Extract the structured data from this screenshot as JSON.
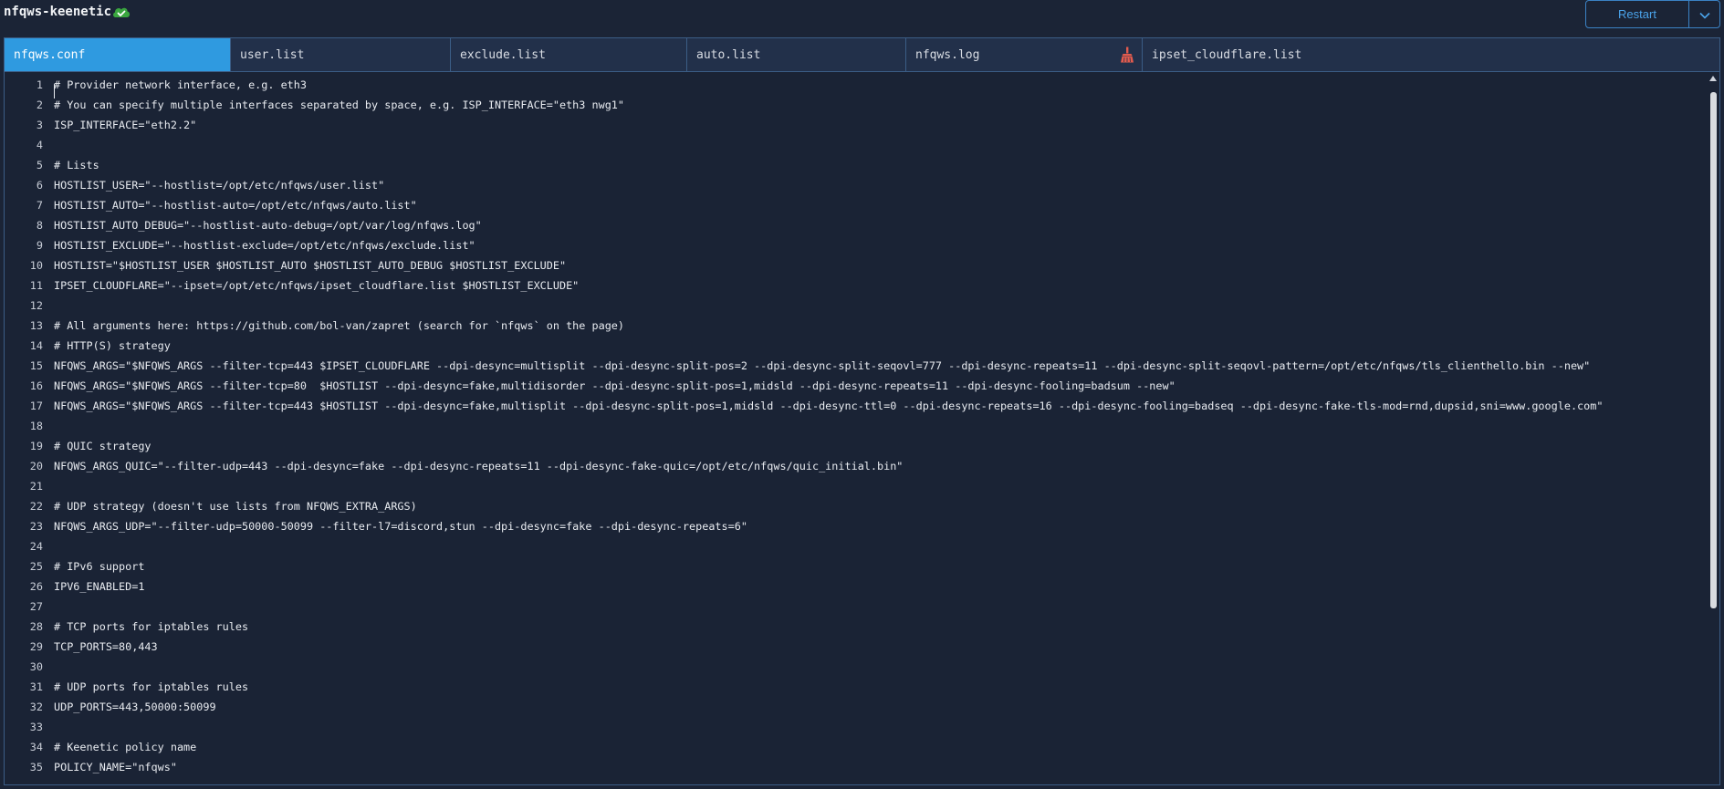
{
  "header": {
    "title": "nfqws-keenetic",
    "status_icon": "cloud-check-icon",
    "restart_label": "Restart"
  },
  "colors": {
    "accent": "#2f9ae0",
    "status_green": "#3aa63f",
    "clear_red": "#e25b4e"
  },
  "tabs": [
    {
      "label": "nfqws.conf",
      "active": true
    },
    {
      "label": "user.list"
    },
    {
      "label": "exclude.list"
    },
    {
      "label": "auto.list"
    },
    {
      "label": "nfqws.log",
      "action_icon": "broom-icon"
    },
    {
      "label": "ipset_cloudflare.list"
    }
  ],
  "editor": {
    "lines": [
      "# Provider network interface, e.g. eth3",
      "# You can specify multiple interfaces separated by space, e.g. ISP_INTERFACE=\"eth3 nwg1\"",
      "ISP_INTERFACE=\"eth2.2\"",
      "",
      "# Lists",
      "HOSTLIST_USER=\"--hostlist=/opt/etc/nfqws/user.list\"",
      "HOSTLIST_AUTO=\"--hostlist-auto=/opt/etc/nfqws/auto.list\"",
      "HOSTLIST_AUTO_DEBUG=\"--hostlist-auto-debug=/opt/var/log/nfqws.log\"",
      "HOSTLIST_EXCLUDE=\"--hostlist-exclude=/opt/etc/nfqws/exclude.list\"",
      "HOSTLIST=\"$HOSTLIST_USER $HOSTLIST_AUTO $HOSTLIST_AUTO_DEBUG $HOSTLIST_EXCLUDE\"",
      "IPSET_CLOUDFLARE=\"--ipset=/opt/etc/nfqws/ipset_cloudflare.list $HOSTLIST_EXCLUDE\"",
      "",
      "# All arguments here: https://github.com/bol-van/zapret (search for `nfqws` on the page)",
      "# HTTP(S) strategy",
      "NFQWS_ARGS=\"$NFQWS_ARGS --filter-tcp=443 $IPSET_CLOUDFLARE --dpi-desync=multisplit --dpi-desync-split-pos=2 --dpi-desync-split-seqovl=777 --dpi-desync-repeats=11 --dpi-desync-split-seqovl-pattern=/opt/etc/nfqws/tls_clienthello.bin --new\"",
      "NFQWS_ARGS=\"$NFQWS_ARGS --filter-tcp=80  $HOSTLIST --dpi-desync=fake,multidisorder --dpi-desync-split-pos=1,midsld --dpi-desync-repeats=11 --dpi-desync-fooling=badsum --new\"",
      "NFQWS_ARGS=\"$NFQWS_ARGS --filter-tcp=443 $HOSTLIST --dpi-desync=fake,multisplit --dpi-desync-split-pos=1,midsld --dpi-desync-ttl=0 --dpi-desync-repeats=16 --dpi-desync-fooling=badseq --dpi-desync-fake-tls-mod=rnd,dupsid,sni=www.google.com\"",
      "",
      "# QUIC strategy",
      "NFQWS_ARGS_QUIC=\"--filter-udp=443 --dpi-desync=fake --dpi-desync-repeats=11 --dpi-desync-fake-quic=/opt/etc/nfqws/quic_initial.bin\"",
      "",
      "# UDP strategy (doesn't use lists from NFQWS_EXTRA_ARGS)",
      "NFQWS_ARGS_UDP=\"--filter-udp=50000-50099 --filter-l7=discord,stun --dpi-desync=fake --dpi-desync-repeats=6\"",
      "",
      "# IPv6 support",
      "IPV6_ENABLED=1",
      "",
      "# TCP ports for iptables rules",
      "TCP_PORTS=80,443",
      "",
      "# UDP ports for iptables rules",
      "UDP_PORTS=443,50000:50099",
      "",
      "# Keenetic policy name",
      "POLICY_NAME=\"nfqws\""
    ]
  }
}
